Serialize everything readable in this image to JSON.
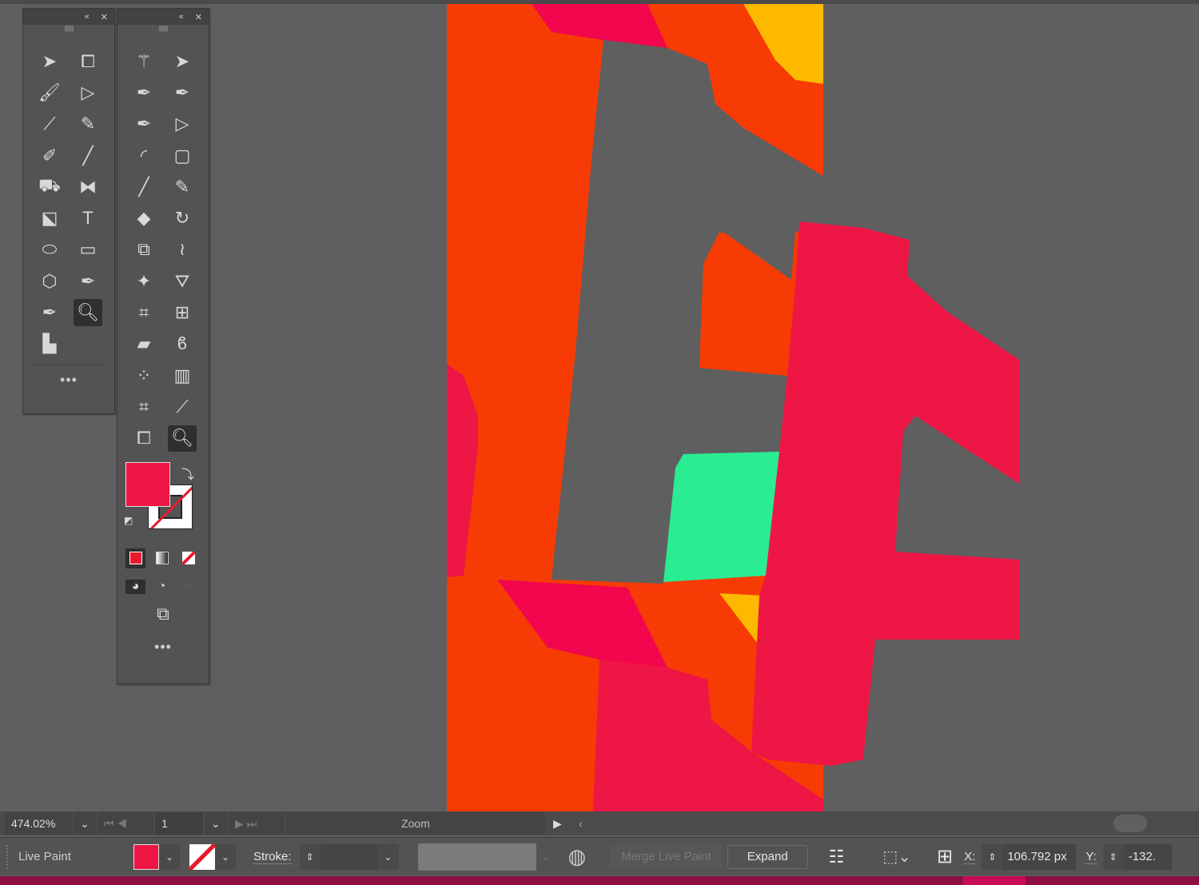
{
  "colors": {
    "fill": "#ee1645",
    "orange": "#f73b05",
    "magenta": "#f2064e",
    "yellow": "#fcb900",
    "green": "#2aec92",
    "canvas": "#5f5f5f"
  },
  "panel1": {
    "tools": [
      "selection",
      "artboard",
      "paintbrush",
      "direct-selection",
      "eyedropper",
      "pencil",
      "blob-brush",
      "line",
      "live-paint-bucket",
      "reflect",
      "free-transform",
      "type",
      "ellipse",
      "rectangle",
      "polygon",
      "pen",
      "curvature-pen",
      "zoom",
      "graph-bar"
    ],
    "active": "zoom",
    "more": "•••"
  },
  "panel2": {
    "tools": [
      "magic-wand",
      "selection",
      "add-anchor",
      "delete-anchor",
      "curvature",
      "direct-selection",
      "arc",
      "rounded-rect",
      "line",
      "pencil",
      "eraser",
      "rotate",
      "scale",
      "warp",
      "puppet-warp",
      "live-paint-selection",
      "perspective",
      "mesh",
      "measure",
      "lasso",
      "symbol-sprayer",
      "column-graph",
      "crop",
      "eyedropper",
      "artboard",
      "zoom"
    ],
    "active": "zoom",
    "more": "•••"
  },
  "status": {
    "zoom": "474.02%",
    "page": "1",
    "tool_label": "Zoom"
  },
  "control": {
    "mode": "Live Paint",
    "stroke_label": "Stroke:",
    "merge": "Merge Live Paint",
    "expand": "Expand",
    "x_label": "X:",
    "x_value": "106.792 px",
    "y_label": "Y:",
    "y_value": "-132."
  }
}
